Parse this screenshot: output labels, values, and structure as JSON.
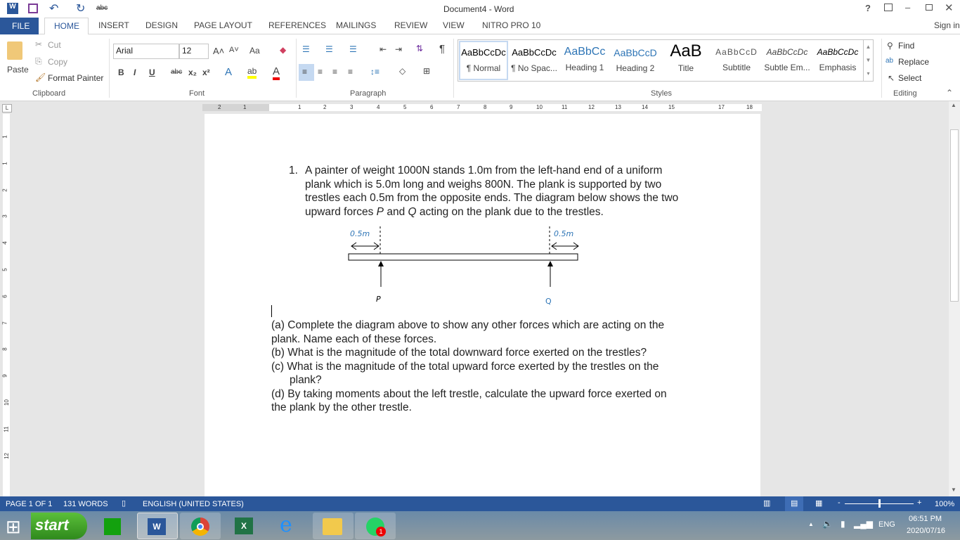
{
  "window": {
    "title": "Document4 - Word",
    "help": "?",
    "sign_in": "Sign in"
  },
  "qat": {
    "undo": "↶",
    "redo": "↻",
    "spell": "abc"
  },
  "tabs": [
    "FILE",
    "HOME",
    "INSERT",
    "DESIGN",
    "PAGE LAYOUT",
    "REFERENCES",
    "MAILINGS",
    "REVIEW",
    "VIEW",
    "NITRO PRO 10"
  ],
  "clipboard": {
    "paste": "Paste",
    "cut": "Cut",
    "copy": "Copy",
    "format_painter": "Format Painter",
    "label": "Clipboard"
  },
  "font": {
    "name": "Arial",
    "size": "12",
    "label": "Font",
    "bold": "B",
    "italic": "I",
    "underline": "U",
    "strike": "abc",
    "sub": "x₂",
    "sup": "x²",
    "case": "Aa",
    "grow": "A˄",
    "shrink": "A˅"
  },
  "paragraph": {
    "label": "Paragraph",
    "pilcrow": "¶"
  },
  "styles": {
    "label": "Styles",
    "items": [
      {
        "preview": "AaBbCcDc",
        "name": "¶ Normal"
      },
      {
        "preview": "AaBbCcDc",
        "name": "¶ No Spac..."
      },
      {
        "preview": "AaBbCc",
        "name": "Heading 1"
      },
      {
        "preview": "AaBbCcD",
        "name": "Heading 2"
      },
      {
        "preview": "AaB",
        "name": "Title"
      },
      {
        "preview": "AaBbCcD",
        "name": "Subtitle"
      },
      {
        "preview": "AaBbCcDc",
        "name": "Subtle Em..."
      },
      {
        "preview": "AaBbCcDc",
        "name": "Emphasis"
      }
    ]
  },
  "editing": {
    "find": "Find",
    "replace": "Replace",
    "select": "Select",
    "label": "Editing"
  },
  "ruler": [
    "2",
    "1",
    "1",
    "2",
    "3",
    "4",
    "5",
    "6",
    "7",
    "8",
    "9",
    "10",
    "11",
    "12",
    "13",
    "14",
    "15",
    "17",
    "18"
  ],
  "vruler": [
    "1",
    "1",
    "2",
    "3",
    "4",
    "5",
    "6",
    "7",
    "8",
    "9",
    "10",
    "11",
    "12"
  ],
  "document": {
    "q_number": "1.",
    "q_lines": [
      "A painter of weight 1000N stands 1.0m from the left-hand end of a uniform",
      "plank which is 5.0m long and weighs 800N. The plank is supported by two",
      "trestles each 0.5m from the opposite ends. The diagram below shows the two",
      "upward forces P and Q acting on the plank due to the trestles."
    ],
    "diagram": {
      "left_dist": "0.5m",
      "right_dist": "0.5m",
      "left_force": "P",
      "right_force": "Q"
    },
    "parts": [
      "(a) Complete the diagram above to show any other forces which are acting on the",
      "plank. Name each of these forces.",
      "(b) What is the magnitude of the total downward force exerted on the trestles?",
      "(c) What is the magnitude of the total upward force exerted by the trestles on the",
      "plank?",
      "(d) By taking moments about the left trestle, calculate the upward force exerted on",
      "the plank by the other trestle."
    ]
  },
  "status": {
    "page": "PAGE 1 OF 1",
    "words": "131 WORDS",
    "language": "ENGLISH (UNITED STATES)",
    "zoom": "100%",
    "zoom_percent": 100
  },
  "taskbar": {
    "start": "start",
    "time": "06:51 PM",
    "date": "2020/07/16",
    "lang": "ENG",
    "whatsapp_badge": "1"
  },
  "colors": {
    "accent": "#2b579a",
    "link_blue": "#2e75b6"
  }
}
